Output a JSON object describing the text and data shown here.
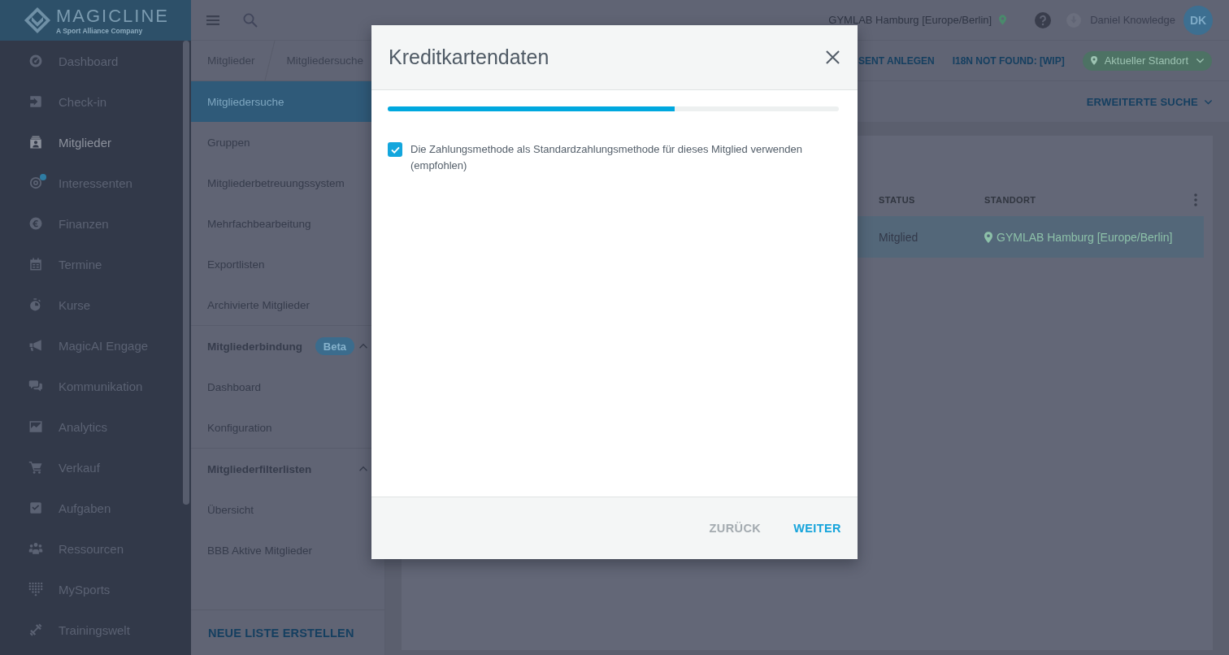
{
  "sidebar": {
    "logo": {
      "wordmark": "MAGICLINE",
      "tagline": "A Sport Alliance Company"
    },
    "items": [
      {
        "label": "Dashboard",
        "selected": false,
        "notification": false
      },
      {
        "label": "Check-in",
        "selected": false,
        "notification": false
      },
      {
        "label": "Mitglieder",
        "selected": true,
        "notification": false
      },
      {
        "label": "Interessenten",
        "selected": false,
        "notification": true
      },
      {
        "label": "Finanzen",
        "selected": false,
        "notification": false
      },
      {
        "label": "Termine",
        "selected": false,
        "notification": false
      },
      {
        "label": "Kurse",
        "selected": false,
        "notification": false
      },
      {
        "label": "MagicAI Engage",
        "selected": false,
        "notification": false
      },
      {
        "label": "Kommunikation",
        "selected": false,
        "notification": false
      },
      {
        "label": "Analytics",
        "selected": false,
        "notification": false
      },
      {
        "label": "Verkauf",
        "selected": false,
        "notification": false
      },
      {
        "label": "Aufgaben",
        "selected": false,
        "notification": false
      },
      {
        "label": "Ressourcen",
        "selected": false,
        "notification": false
      },
      {
        "label": "MySports",
        "selected": false,
        "notification": false
      },
      {
        "label": "Trainingswelt",
        "selected": false,
        "notification": false
      }
    ]
  },
  "topbar": {
    "location": "GYMLAB Hamburg [Europe/Berlin]",
    "user_name": "Daniel Knowledge",
    "avatar_initials": "DK"
  },
  "breadcrumb": [
    {
      "label": "Mitglieder"
    },
    {
      "label": "Mitgliedersuche"
    }
  ],
  "header_actions": [
    {
      "label": "SENT ANLEGEN"
    },
    {
      "label": "I18N NOT FOUND: [WIP]"
    }
  ],
  "location_filter": {
    "label": "Aktueller Standort"
  },
  "subnav": {
    "items": [
      {
        "label": "Mitgliedersuche",
        "selected": true
      },
      {
        "label": "Gruppen",
        "selected": false
      },
      {
        "label": "Mitgliederbetreuungssystem",
        "selected": false
      },
      {
        "label": "Mehrfachbearbeitung",
        "selected": false
      },
      {
        "label": "Exportlisten",
        "selected": false
      },
      {
        "label": "Archivierte Mitglieder",
        "selected": false
      }
    ],
    "sections": [
      {
        "title": "Mitgliederbindung",
        "badge": "Beta",
        "expanded": true,
        "items": [
          {
            "label": "Dashboard",
            "selected": false
          },
          {
            "label": "Konfiguration",
            "selected": false
          }
        ]
      },
      {
        "title": "Mitgliederfilterlisten",
        "expanded": true,
        "items": [
          {
            "label": "Übersicht",
            "selected": false
          },
          {
            "label": "BBB Aktive Mitglieder",
            "selected": false
          }
        ]
      }
    ],
    "create_button": "NEUE LISTE ERSTELLEN"
  },
  "search_panel": {
    "advanced_search": "ERWEITERTE SUCHE"
  },
  "table": {
    "columns": [
      "STATUS",
      "STANDORT"
    ],
    "rows": [
      {
        "status": "Mitglied",
        "location": "GYMLAB Hamburg [Europe/Berlin]",
        "selected": true
      }
    ]
  },
  "dialog": {
    "title": "Kreditkartendaten",
    "progress": {
      "level": 0.636
    },
    "default_payment": {
      "label": "Die Zahlungsmethode als Standardzahlungsmethode für dieses Mitglied verwenden (empfohlen)",
      "checked": true
    },
    "buttons": [
      {
        "label": "ZURÜCK",
        "kind": "secondary"
      },
      {
        "label": "WEITER",
        "kind": "primary"
      }
    ]
  }
}
